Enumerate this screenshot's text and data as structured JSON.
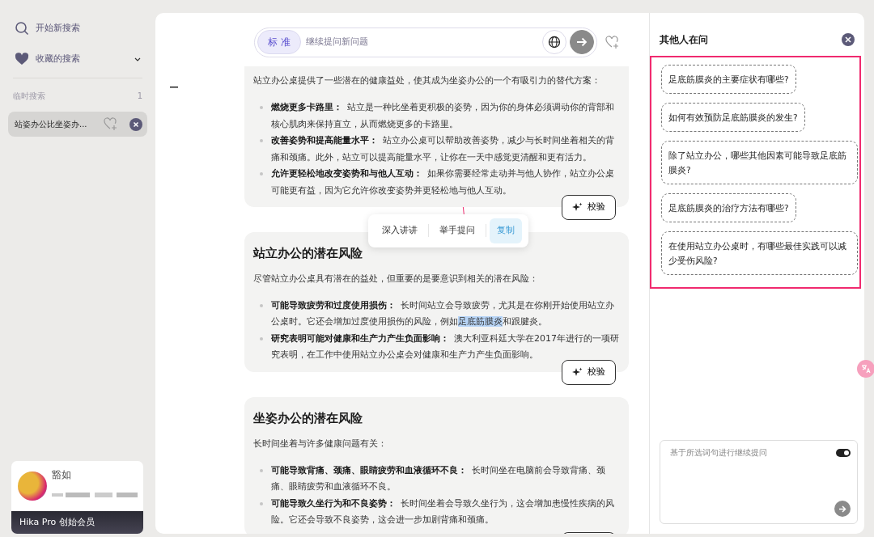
{
  "sidebar": {
    "items": [
      {
        "kind": "search",
        "label": "开始新搜索"
      },
      {
        "kind": "favorites",
        "label": "收藏的搜索",
        "expanded": false
      }
    ],
    "section": {
      "title": "临时搜索",
      "count": "1"
    },
    "history": [
      {
        "title": "站姿办公比坐姿办...",
        "selected": true
      }
    ],
    "user": {
      "name": "豁如",
      "membership": "Hika Pro 创始会员"
    }
  },
  "search_bar": {
    "mode": "标 准",
    "placeholder": "继续提问新问题"
  },
  "cards": [
    {
      "intro": "站立办公桌提供了一些潜在的健康益处，使其成为坐姿办公的一个有吸引力的替代方案：",
      "bullets": [
        {
          "term": "燃烧更多卡路里：",
          "parts": [
            {
              "text": "站立是一种比坐着更积极的姿势，因为你的身体必须调动你的背部和核心肌肉来保持直立，从而燃烧更多的卡路里。",
              "selected": false
            }
          ]
        },
        {
          "term": "改善姿势和提高能量水平：",
          "parts": [
            {
              "text": "站立办公桌可以帮助改善姿势，减少与长时间坐着相关的背痛和颈痛。此外，站立可以提高能量水平，让你在一天中感觉更清醒和更有活力。",
              "selected": false
            }
          ]
        },
        {
          "term": "允许更轻松地改变姿势和与他人互动：",
          "parts": [
            {
              "text": "如果你需要经常走动并与他人协作，站立办公桌可能更有益，因为它允许你改变姿势并更轻松地与他人互动。",
              "selected": false
            }
          ]
        }
      ],
      "check_button": "校验"
    },
    {
      "heading": "站立办公的潜在风险",
      "intro": "尽管站立办公桌具有潜在的益处，但重要的是要意识到相关的潜在风险：",
      "bullets": [
        {
          "term": "可能导致疲劳和过度使用损伤：",
          "parts": [
            {
              "text": "长时间站立会导致疲劳，尤其是在你刚开始使用站立办公桌时。它还会增加过度使用损伤的风险，例如",
              "selected": false
            },
            {
              "text": "足底筋膜炎",
              "selected": true
            },
            {
              "text": "和跟腱炎。",
              "selected": false
            }
          ]
        },
        {
          "term": "研究表明可能对健康和生产力产生负面影响：",
          "parts": [
            {
              "text": "澳大利亚科廷大学在2017年进行的一项研究表明，在工作中使用站立办公桌会对健康和生产力产生负面影响。",
              "selected": false
            }
          ]
        }
      ],
      "check_button": "校验",
      "popup": [
        {
          "label": "深入讲讲",
          "selected": false
        },
        {
          "label": "举手提问",
          "selected": false
        },
        {
          "label": "复制",
          "selected": true
        }
      ]
    },
    {
      "heading": "坐姿办公的潜在风险",
      "intro": "长时间坐着与许多健康问题有关：",
      "bullets": [
        {
          "term": "可能导致背痛、颈痛、眼睛疲劳和血液循环不良：",
          "parts": [
            {
              "text": "长时间坐在电脑前会导致背痛、颈痛、眼睛疲劳和血液循环不良。",
              "selected": false
            }
          ]
        },
        {
          "term": "可能导致久坐行为和不良姿势：",
          "parts": [
            {
              "text": "长时间坐着会导致久坐行为，这会增加患慢性疾病的风险。它还会导致不良姿势，这会进一步加剧背痛和颈痛。",
              "selected": false
            }
          ]
        }
      ],
      "has_cut_button": true
    }
  ],
  "related": {
    "title": "其他人在问",
    "questions": [
      "足底筋膜炎的主要症状有哪些?",
      "如何有效预防足底筋膜炎的发生?",
      "除了站立办公，哪些其他因素可能导致足底筋膜炎?",
      "足底筋膜炎的治疗方法有哪些?",
      "在使用站立办公桌时，有哪些最佳实践可以减少受伤风险?"
    ]
  },
  "followup": {
    "placeholder": "基于所选词句进行继续提问",
    "toggle_on": true
  }
}
